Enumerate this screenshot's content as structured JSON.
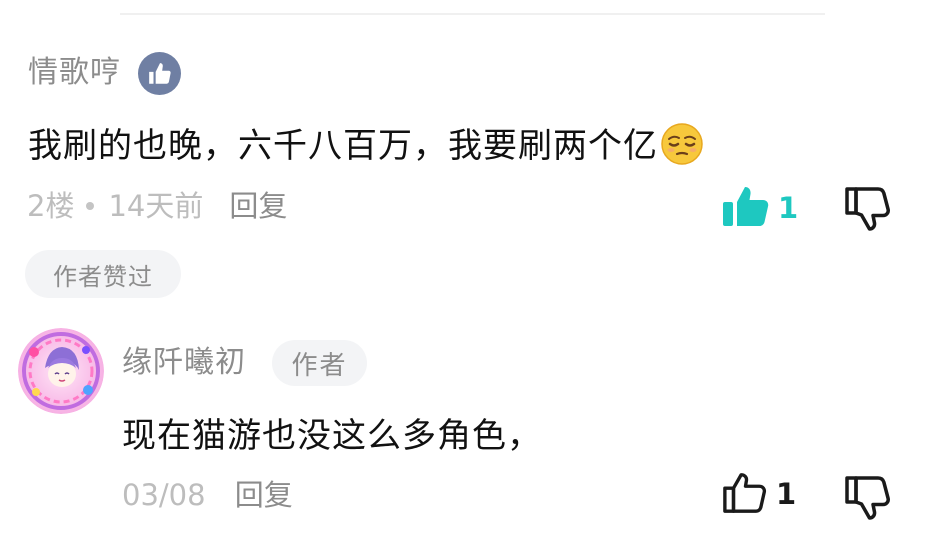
{
  "comment1": {
    "username": "情歌哼",
    "text": "我刷的也晚，六千八百万，我要刷两个亿",
    "floor": "2楼",
    "time": "14天前",
    "reply_label": "回复",
    "like_count": "1",
    "liked": true,
    "author_liked_label": "作者赞过",
    "badge_icon": "thumbs-up-badge",
    "emoji": "relieved-face-emoji"
  },
  "comment2": {
    "username": "缘阡曦初",
    "author_tag": "作者",
    "text": "现在猫游也没这么多角色，",
    "date": "03/08",
    "reply_label": "回复",
    "like_count": "1",
    "liked": false
  },
  "colors": {
    "liked_accent": "#1ec8c0",
    "muted_text": "#8c8c8c",
    "meta_text": "#bdbdbd",
    "pill_bg": "#f3f4f6",
    "badge_bg": "#6f7fa3"
  }
}
